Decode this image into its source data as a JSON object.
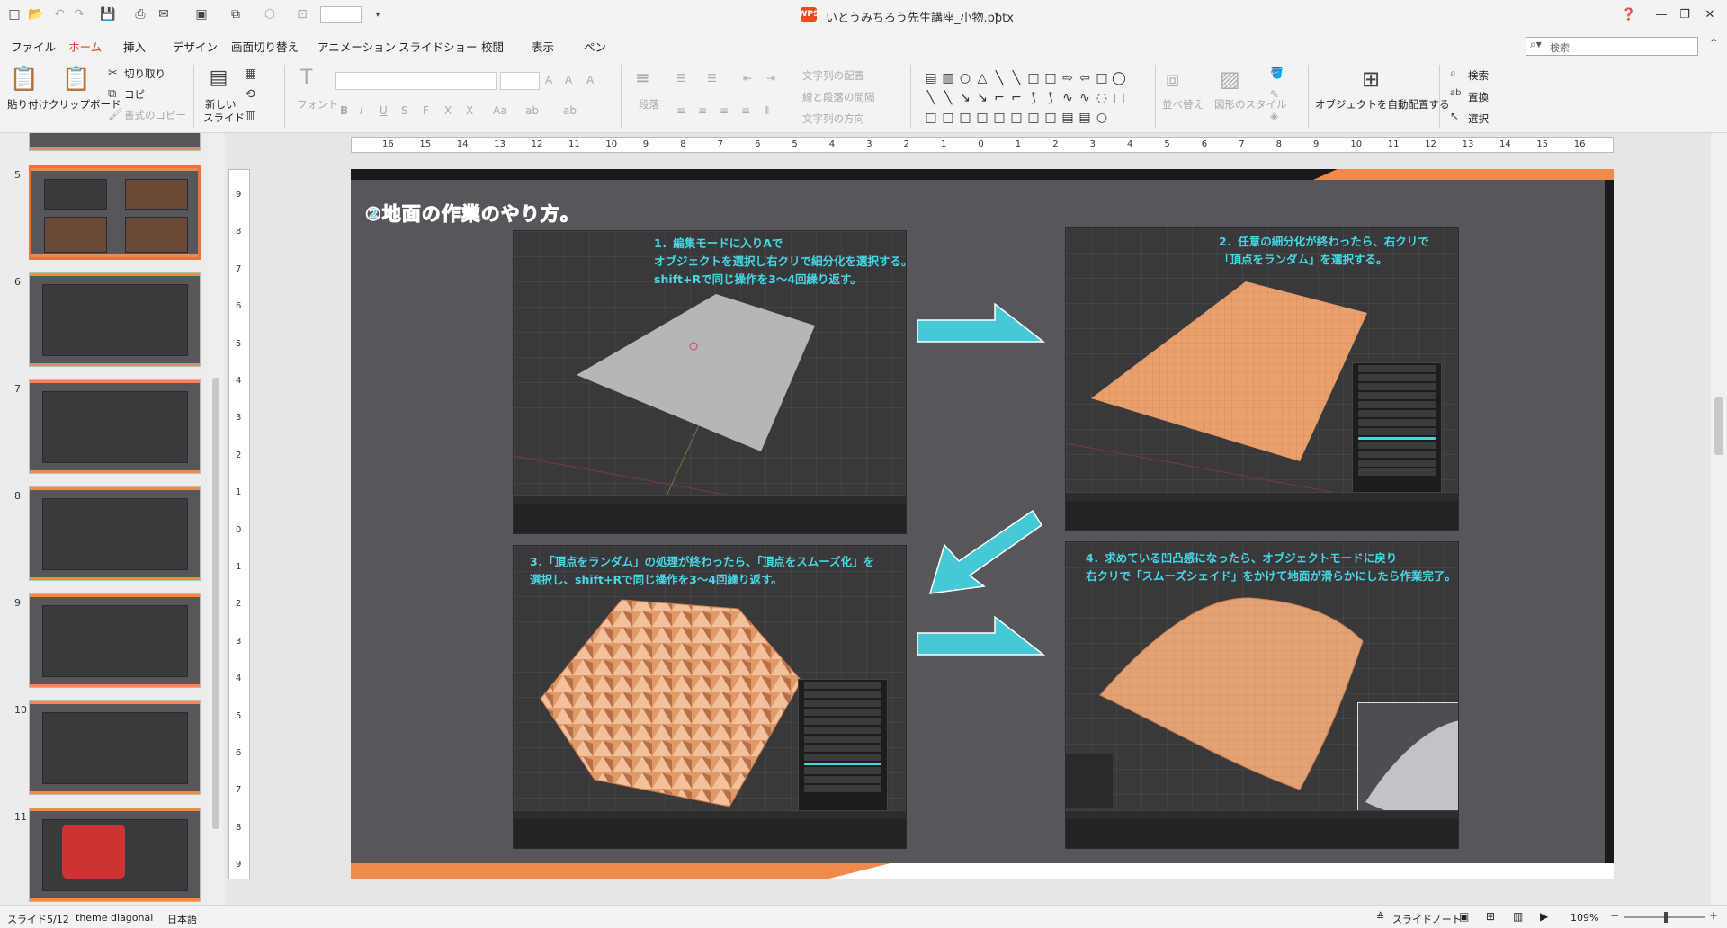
{
  "window": {
    "title": "いとうみちろう先生講座_小物.pptx",
    "logo_text": "WPS"
  },
  "menu": {
    "tabs": [
      "ファイル",
      "ホーム",
      "挿入",
      "デザイン",
      "画面切り替え",
      "アニメーション",
      "スライドショー",
      "校閲",
      "表示",
      "ペン"
    ],
    "search_placeholder": "検索"
  },
  "ribbon": {
    "paste": "貼り付け",
    "clipboard": "クリップボード",
    "cut": "切り取り",
    "copy": "コピー",
    "format_copy": "書式のコピー",
    "new_slide_1": "新しい",
    "new_slide_2": "スライド",
    "font": "フォント",
    "paragraph": "段落",
    "text_direction": "文字列の配置",
    "line_spacing": "線と段落の間隔",
    "text_dir2": "文字列の方向",
    "arrange": "並べ替え",
    "shape_style": "図形のスタイル",
    "auto_arrange": "オブジェクトを自動配置する",
    "find": "検索",
    "replace": "置換",
    "select": "選択"
  },
  "ruler": {
    "h_ticks": [
      "16",
      "15",
      "14",
      "13",
      "12",
      "11",
      "10",
      "9",
      "8",
      "7",
      "6",
      "5",
      "4",
      "3",
      "2",
      "1",
      "0",
      "1",
      "2",
      "3",
      "4",
      "5",
      "6",
      "7",
      "8",
      "9",
      "10",
      "11",
      "12",
      "13",
      "14",
      "15",
      "16"
    ],
    "v_ticks": [
      "9",
      "8",
      "7",
      "6",
      "5",
      "4",
      "3",
      "2",
      "1",
      "0",
      "1",
      "2",
      "3",
      "4",
      "5",
      "6",
      "7",
      "8",
      "9"
    ]
  },
  "slides": {
    "numbers": [
      "5",
      "6",
      "7",
      "8",
      "9",
      "10",
      "11"
    ],
    "current": "5"
  },
  "slide": {
    "title": "②地面の作業のやり方。",
    "step1_l1": "1．編集モードに入りAで",
    "step1_l2": "オブジェクトを選択し右クリで細分化を選択する。",
    "step1_l3": "shift+Rで同じ操作を3～4回繰り返す。",
    "step2_l1": "2．任意の細分化が終わったら、右クリで",
    "step2_l2": "「頂点をランダム」を選択する。",
    "step3_l1": "3．「頂点をランダム」の処理が終わったら、「頂点をスムーズ化」を",
    "step3_l2": "選択し、shift+Rで同じ操作を3～4回繰り返す。",
    "step4_l1": "4．求めている凹凸感になったら、オブジェクトモードに戻り",
    "step4_l2": "右クリで「スムーズシェイド」をかけて地面が滑らかにしたら作業完了。"
  },
  "status": {
    "slide_info": "スライド5/12",
    "theme": "theme diagonal",
    "lang": "日本語",
    "notes": "スライドノート",
    "zoom": "109%"
  },
  "colors": {
    "accent_orange": "#f08a4b",
    "cyan_text": "#45d9e6",
    "slide_bg": "#57575b"
  }
}
